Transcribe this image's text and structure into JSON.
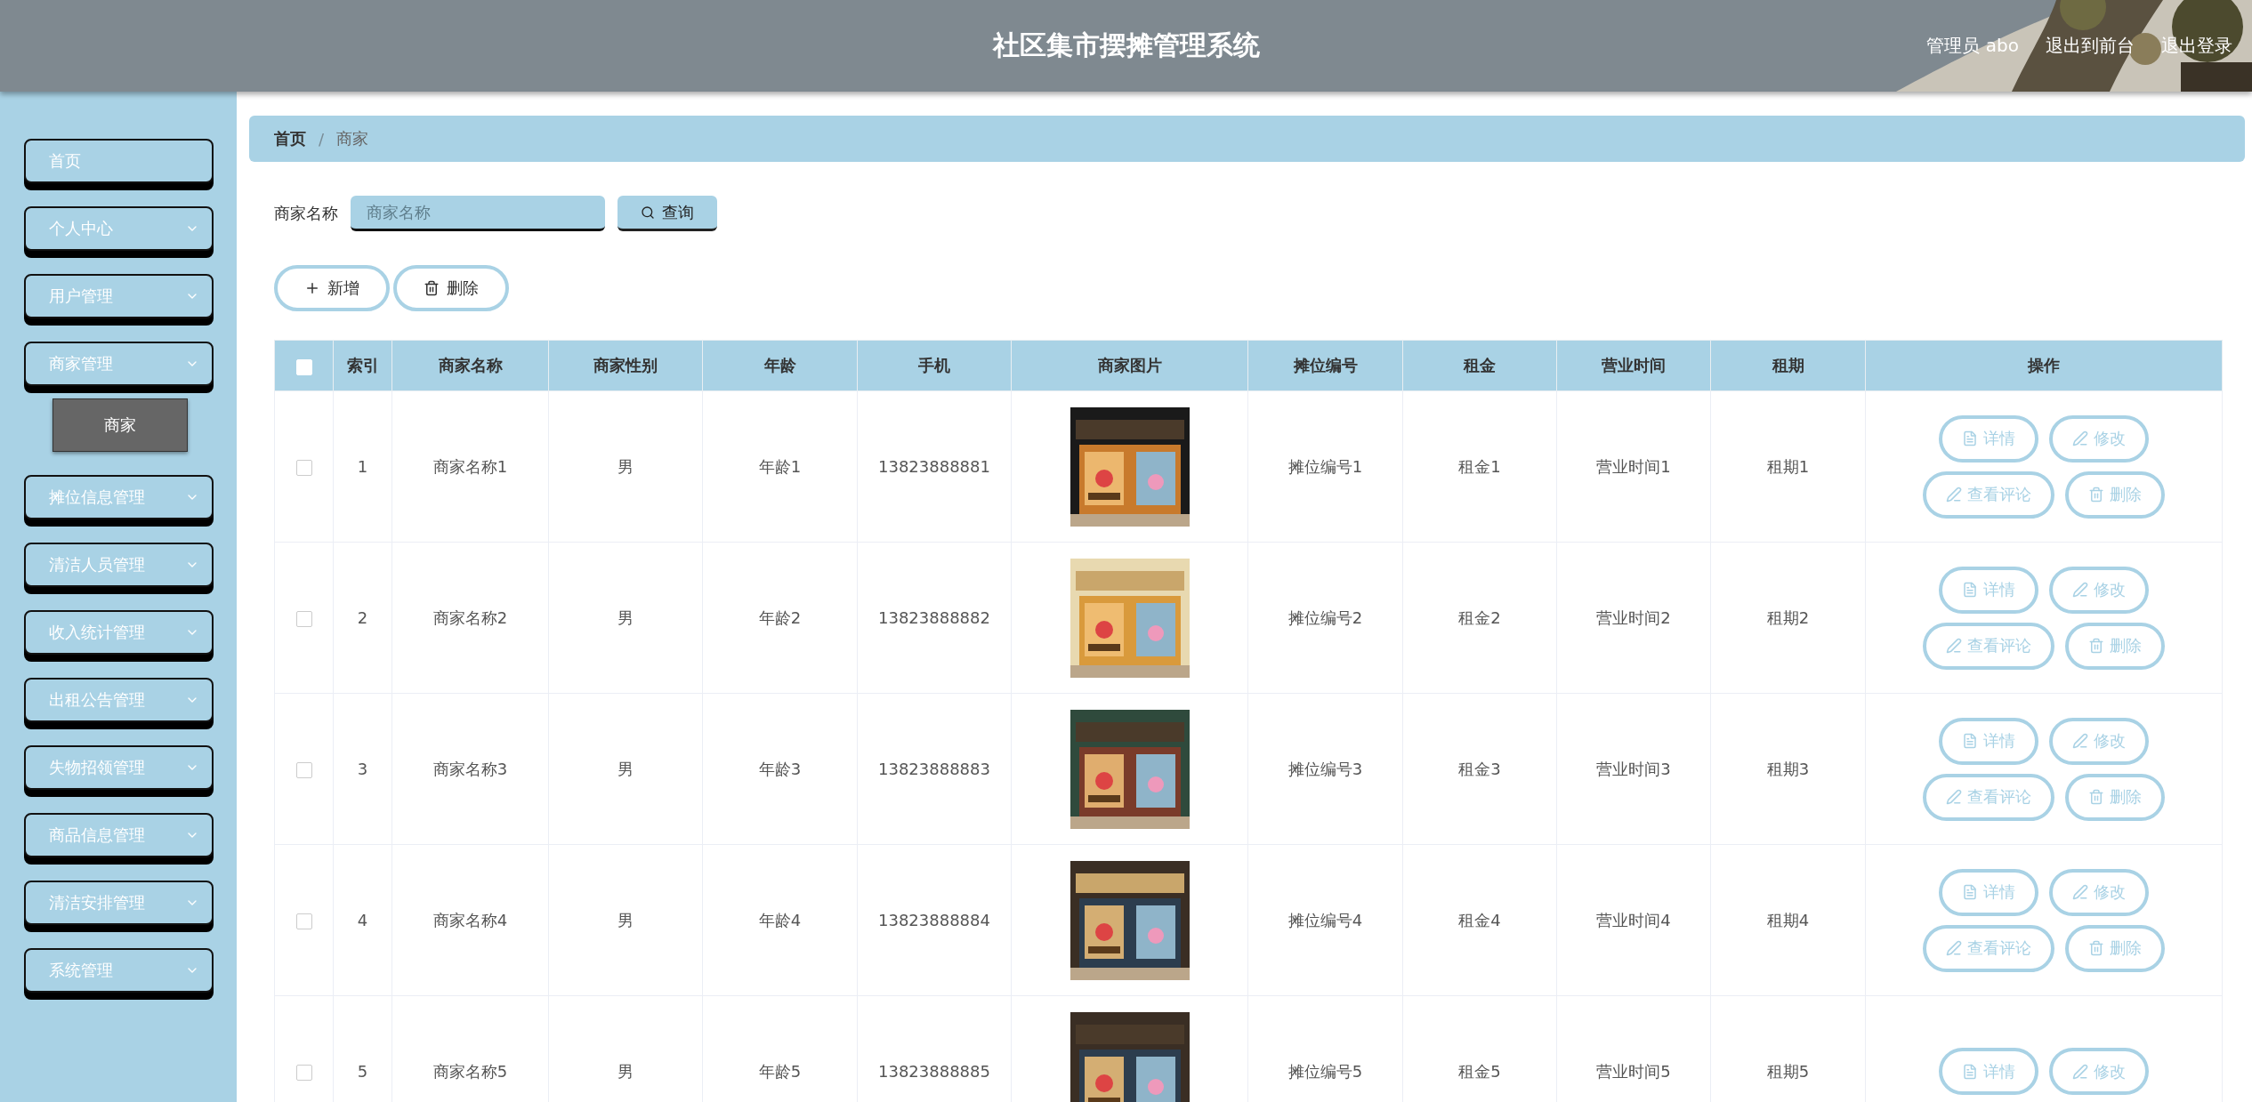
{
  "header": {
    "title": "社区集市摆摊管理系统",
    "links": [
      "管理员 abo",
      "退出到前台",
      "退出登录"
    ]
  },
  "sidebar": {
    "items": [
      {
        "label": "首页",
        "kind": "link",
        "selected": false
      },
      {
        "label": "个人中心",
        "kind": "submenu",
        "selected": false
      },
      {
        "label": "用户管理",
        "kind": "submenu",
        "selected": false
      },
      {
        "label": "商家管理",
        "kind": "submenu",
        "selected": false,
        "children": [
          {
            "label": "商家",
            "selected": true
          }
        ]
      },
      {
        "label": "摊位信息管理",
        "kind": "submenu",
        "selected": false
      },
      {
        "label": "清洁人员管理",
        "kind": "submenu",
        "selected": false
      },
      {
        "label": "收入统计管理",
        "kind": "submenu",
        "selected": false
      },
      {
        "label": "出租公告管理",
        "kind": "submenu",
        "selected": false
      },
      {
        "label": "失物招领管理",
        "kind": "submenu",
        "selected": false
      },
      {
        "label": "商品信息管理",
        "kind": "submenu",
        "selected": false
      },
      {
        "label": "清洁安排管理",
        "kind": "submenu",
        "selected": false
      },
      {
        "label": "系统管理",
        "kind": "submenu",
        "selected": false
      }
    ]
  },
  "breadcrumb": {
    "separator": "/",
    "items": [
      "首页",
      "商家"
    ]
  },
  "search": {
    "label": "商家名称",
    "placeholder": "商家名称",
    "button": "查询"
  },
  "toolbar": [
    "新增",
    "删除"
  ],
  "table": {
    "select_all": {
      "checked": false
    },
    "columns": [
      "索引",
      "商家名称",
      "商家性别",
      "年龄",
      "手机",
      "商家图片",
      "摊位编号",
      "租金",
      "营业时间",
      "租期",
      "操作"
    ],
    "rows": [
      {
        "checked": false,
        "cells": [
          "1",
          "商家名称1",
          "男",
          "年龄1",
          "13823888881",
          {
            "kind": "picture"
          },
          "摊位编号1",
          "租金1",
          "营业时间1",
          "租期1"
        ],
        "actions": [
          "详情",
          "修改",
          "查看评论",
          "删除"
        ]
      },
      {
        "checked": false,
        "cells": [
          "2",
          "商家名称2",
          "男",
          "年龄2",
          "13823888882",
          {
            "kind": "picture"
          },
          "摊位编号2",
          "租金2",
          "营业时间2",
          "租期2"
        ],
        "actions": [
          "详情",
          "修改",
          "查看评论",
          "删除"
        ]
      },
      {
        "checked": false,
        "cells": [
          "3",
          "商家名称3",
          "男",
          "年龄3",
          "13823888883",
          {
            "kind": "picture"
          },
          "摊位编号3",
          "租金3",
          "营业时间3",
          "租期3"
        ],
        "actions": [
          "详情",
          "修改",
          "查看评论",
          "删除"
        ]
      },
      {
        "checked": false,
        "cells": [
          "4",
          "商家名称4",
          "男",
          "年龄4",
          "13823888884",
          {
            "kind": "picture"
          },
          "摊位编号4",
          "租金4",
          "营业时间4",
          "租期4"
        ],
        "actions": [
          "详情",
          "修改",
          "查看评论",
          "删除"
        ]
      },
      {
        "checked": false,
        "cells": [
          "5",
          "商家名称5",
          "男",
          "年龄5",
          "13823888885",
          {
            "kind": "picture"
          },
          "摊位编号5",
          "租金5",
          "营业时间5",
          "租期5"
        ],
        "actions": [
          "详情",
          "修改"
        ]
      }
    ]
  }
}
